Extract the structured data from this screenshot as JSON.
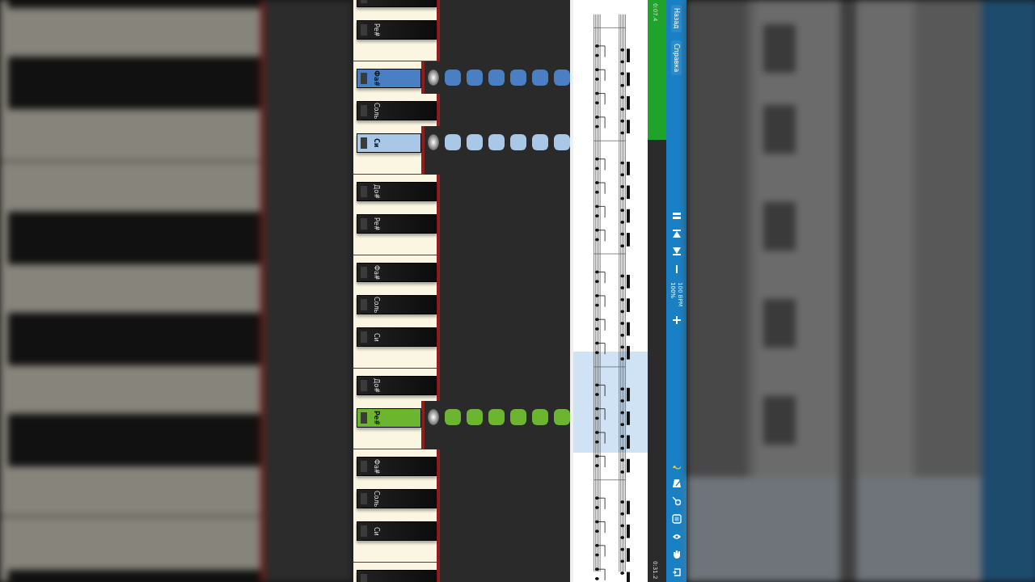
{
  "keys": [
    {
      "pressed": false,
      "gap_after": false
    },
    {
      "label": "Ре#",
      "pressed": false,
      "gap_after": true
    },
    {
      "label": "Фа#",
      "pressed": true,
      "color": "#4a7fc4",
      "gap_after": false
    },
    {
      "label": "Соль",
      "pressed": false,
      "gap_after": false
    },
    {
      "label": "Си",
      "pressed": true,
      "color": "#a9c8e8",
      "gap_after": true
    },
    {
      "label": "До#",
      "pressed": false,
      "gap_after": false
    },
    {
      "label": "Ре#",
      "pressed": false,
      "gap_after": true
    },
    {
      "label": "Фа#",
      "pressed": false,
      "gap_after": false
    },
    {
      "label": "Соль",
      "pressed": false,
      "gap_after": false
    },
    {
      "label": "Си",
      "pressed": false,
      "gap_after": true
    },
    {
      "label": "До#",
      "pressed": false,
      "gap_after": false
    },
    {
      "label": "Ре#",
      "pressed": true,
      "color": "#6cb52e",
      "gap_after": true
    },
    {
      "label": "Фа#",
      "pressed": false,
      "gap_after": false
    },
    {
      "label": "Соль",
      "pressed": false,
      "gap_after": false
    },
    {
      "label": "Си",
      "pressed": false,
      "gap_after": true
    },
    {
      "pressed": false,
      "gap_after": false
    }
  ],
  "progress": {
    "level": 0.24,
    "elapsed": "0:07.4",
    "total": "0:31.2"
  },
  "sidebar": {
    "buttons": [
      {
        "label": "Назад"
      },
      {
        "label": "Справка"
      }
    ],
    "speed": "100%",
    "bpm": "100 BPM"
  }
}
